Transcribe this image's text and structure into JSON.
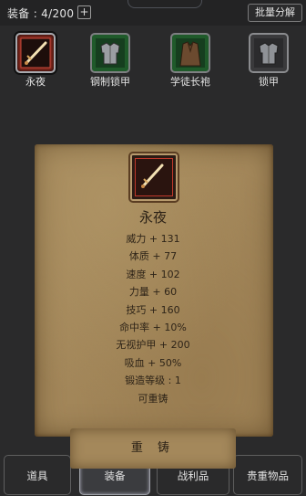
{
  "header": {
    "count_label": "装备 : 4/200",
    "add_symbol": "+",
    "batch_label": "批量分解"
  },
  "slots": [
    {
      "name": "永夜",
      "selected": true
    },
    {
      "name": "钢制锁甲",
      "selected": false
    },
    {
      "name": "学徒长袍",
      "selected": false
    },
    {
      "name": "锁甲",
      "selected": false
    }
  ],
  "detail": {
    "title": "永夜",
    "stats": [
      "威力 + 131",
      "体质 + 77",
      "速度 + 102",
      "力量 + 60",
      "技巧 + 160",
      "命中率 + 10%",
      "无视护甲 + 200",
      "吸血 + 50%",
      "锻造等级 : 1",
      "可重铸"
    ],
    "reforge_label": "重 铸"
  },
  "tabs": [
    {
      "label": "道具"
    },
    {
      "label": "装备",
      "active": true
    },
    {
      "label": "战利品"
    },
    {
      "label": "贵重物品"
    }
  ]
}
